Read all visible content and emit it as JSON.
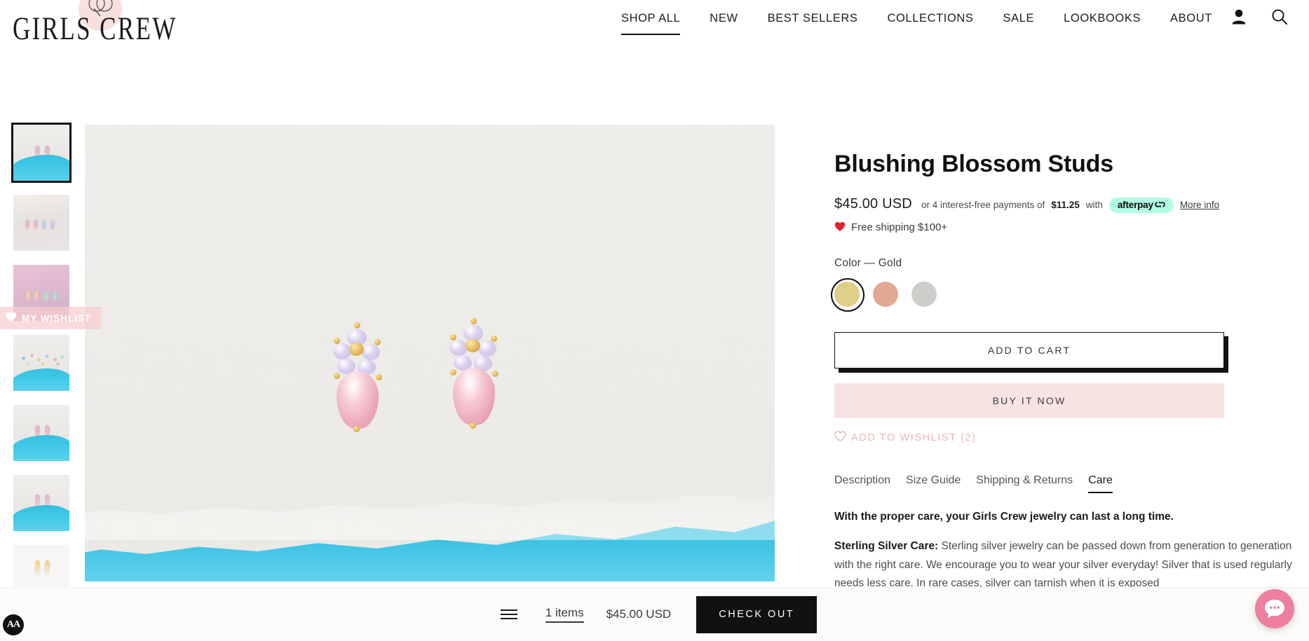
{
  "header": {
    "logo_text": "GIRLS CREW",
    "nav": [
      {
        "label": "SHOP ALL",
        "active": true
      },
      {
        "label": "NEW",
        "active": false
      },
      {
        "label": "BEST SELLERS",
        "active": false
      },
      {
        "label": "COLLECTIONS",
        "active": false
      },
      {
        "label": "SALE",
        "active": false
      },
      {
        "label": "LOOKBOOKS",
        "active": false
      },
      {
        "label": "ABOUT",
        "active": false
      }
    ],
    "icons": [
      {
        "name": "account-icon"
      },
      {
        "name": "search-icon"
      }
    ]
  },
  "gallery": {
    "wishlist_tab_label": "MY WISHLIST",
    "thumbnails": [
      {
        "alt": "Blushing Blossom Studs on white paper with blue torn edge",
        "active": true
      },
      {
        "alt": "Four pairs of studs in a row on pale background",
        "active": false
      },
      {
        "alt": "Studs on pink glitter background",
        "active": false
      },
      {
        "alt": "Scattered gemstones on white and blue",
        "active": false
      },
      {
        "alt": "Studs front view on white and blue",
        "active": false
      },
      {
        "alt": "Pink star studs on white and blue",
        "active": false
      },
      {
        "alt": "Gold star studs on white background",
        "active": false
      }
    ],
    "main_image_alt": "Pink and lilac crystal flower stud earrings on textured white paper with blue torn edge"
  },
  "product": {
    "title": "Blushing Blossom Studs",
    "price": "$45.00 USD",
    "installments_prefix": "or 4 interest-free payments of",
    "installment_amount": "$11.25",
    "installments_suffix": "with",
    "afterpay_label": "afterpay",
    "more_info_label": "More info",
    "free_shipping": "Free shipping $100+",
    "heart_icon": "❤️",
    "color_label": "Color — Gold",
    "swatches": [
      {
        "name": "Gold",
        "hex": "#ddcf86",
        "selected": true
      },
      {
        "name": "Rose Gold",
        "hex": "#e3a894",
        "selected": false
      },
      {
        "name": "Silver",
        "hex": "#cdcdc9",
        "selected": false
      }
    ],
    "add_to_cart_label": "ADD TO CART",
    "buy_now_label": "BUY IT NOW",
    "wishlist_label": "ADD TO WISHLIST (2)",
    "wishlist_count": "(2)"
  },
  "tabs": [
    {
      "label": "Description",
      "active": false
    },
    {
      "label": "Size Guide",
      "active": false
    },
    {
      "label": "Shipping & Returns",
      "active": false
    },
    {
      "label": "Care",
      "active": true
    }
  ],
  "care_content": {
    "lead": "With the proper care, your Girls Crew jewelry can last a long time.",
    "paragraph_label": "Sterling Silver Care:",
    "paragraph_text": " Sterling silver jewelry can be passed down from generation to generation with the right care. We encourage you to wear your silver everyday! Silver that is used regularly needs less care. In rare cases, silver can tarnish when it is exposed"
  },
  "cart_bar": {
    "items_label": "1 items",
    "total_label": "$45.00 USD",
    "checkout_label": "CHECK OUT",
    "menu_icon": "hamburger-icon"
  },
  "widgets": {
    "accessibility_label": "AA",
    "chat_icon": "chat-bubble-icon"
  },
  "colors": {
    "brand_pink": "#f8e3e3",
    "wishlist_pink": "#f0b3b6",
    "afterpay_mint": "#b2fce4",
    "chat_pink": "#ef7f9e",
    "black": "#111111"
  }
}
